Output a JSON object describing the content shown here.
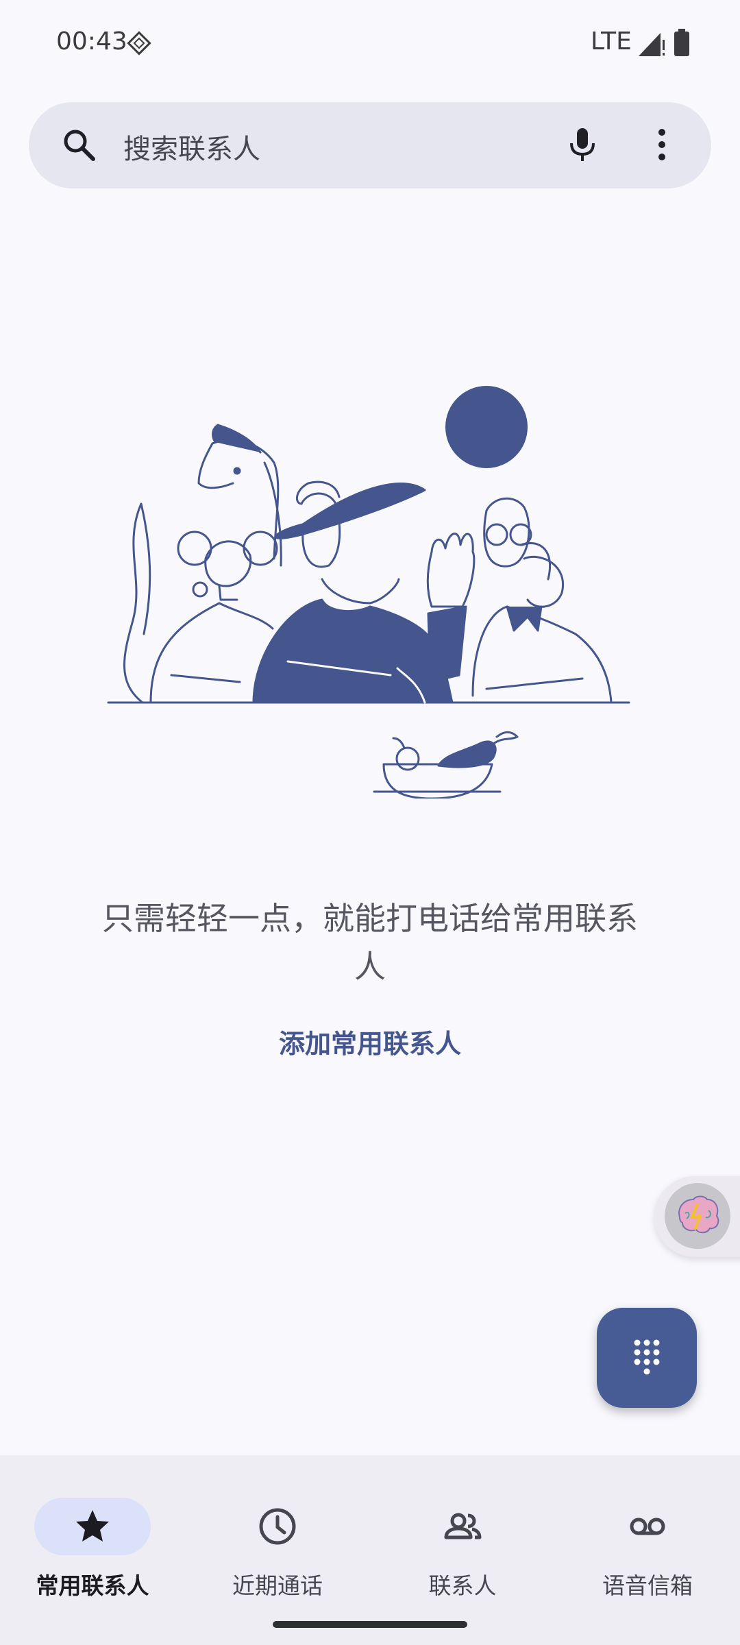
{
  "status_bar": {
    "time": "00:43",
    "network": "LTE",
    "icons": [
      "signal-icon",
      "battery-icon",
      "diamond-notification-icon"
    ]
  },
  "search": {
    "placeholder": "搜索联系人",
    "icons": [
      "search-icon",
      "mic-icon",
      "more-vert-icon"
    ]
  },
  "empty_state": {
    "message": "只需轻轻一点，就能打电话给常用联系人",
    "action": "添加常用联系人"
  },
  "fab": {
    "icon": "dialpad-icon"
  },
  "bubble": {
    "icon": "brain-icon"
  },
  "nav": {
    "items": [
      {
        "label": "常用联系人",
        "icon": "star-icon",
        "active": true
      },
      {
        "label": "近期通话",
        "icon": "clock-icon",
        "active": false
      },
      {
        "label": "联系人",
        "icon": "people-icon",
        "active": false
      },
      {
        "label": "语音信箱",
        "icon": "voicemail-icon",
        "active": false
      }
    ]
  },
  "colors": {
    "background": "#f8f8fd",
    "accent": "#475b94",
    "search_bg": "#e6e6f1",
    "nav_bg": "#ededf3",
    "active_pill": "#dbe1f9"
  }
}
